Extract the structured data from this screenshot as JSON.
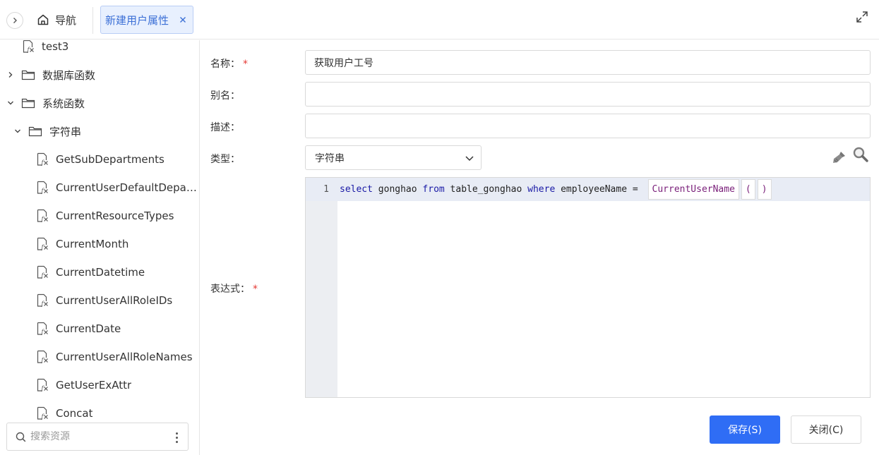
{
  "topbar": {
    "nav_label": "导航",
    "active_tab": "新建用户属性"
  },
  "sidebar": {
    "items": [
      {
        "label": "test3",
        "kind": "function",
        "level": 1
      },
      {
        "label": "数据库函数",
        "kind": "folder",
        "expanded": false,
        "level": 0
      },
      {
        "label": "系统函数",
        "kind": "folder",
        "expanded": true,
        "level": 0
      },
      {
        "label": "字符串",
        "kind": "folder",
        "expanded": true,
        "level": 1
      },
      {
        "label": "GetSubDepartments",
        "kind": "function",
        "level": 2
      },
      {
        "label": "CurrentUserDefaultDepar...",
        "kind": "function",
        "level": 2
      },
      {
        "label": "CurrentResourceTypes",
        "kind": "function",
        "level": 2
      },
      {
        "label": "CurrentMonth",
        "kind": "function",
        "level": 2
      },
      {
        "label": "CurrentDatetime",
        "kind": "function",
        "level": 2
      },
      {
        "label": "CurrentUserAllRoleIDs",
        "kind": "function",
        "level": 2
      },
      {
        "label": "CurrentDate",
        "kind": "function",
        "level": 2
      },
      {
        "label": "CurrentUserAllRoleNames",
        "kind": "function",
        "level": 2
      },
      {
        "label": "GetUserExAttr",
        "kind": "function",
        "level": 2
      },
      {
        "label": "Concat",
        "kind": "function",
        "level": 2
      }
    ],
    "search_placeholder": "搜索资源"
  },
  "form": {
    "name_label": "名称：",
    "name_value": "获取用户工号",
    "alias_label": "别名：",
    "alias_value": "",
    "desc_label": "描述：",
    "desc_value": "",
    "type_label": "类型：",
    "type_value": "字符串",
    "expr_label": "表达式：",
    "required_mark": "*"
  },
  "editor": {
    "line_number": "1",
    "tokens": [
      {
        "text": "select",
        "kw": true
      },
      {
        "text": " gonghao ",
        "kw": false
      },
      {
        "text": "from",
        "kw": true
      },
      {
        "text": " table_gonghao ",
        "kw": false
      },
      {
        "text": "where",
        "kw": true
      },
      {
        "text": " employeeName = ",
        "kw": false
      }
    ],
    "function_chip": "CurrentUserName",
    "paren_open": "(",
    "paren_close": ")"
  },
  "buttons": {
    "save": "保存(S)",
    "close": "关闭(C)"
  },
  "colors": {
    "accent": "#2f6df5",
    "tab_bg": "#e8f0fe",
    "tab_text": "#3b6fd6",
    "required": "#e53935",
    "keyword": "#1a1aa6",
    "function": "#7a1f7a"
  },
  "icons": {
    "collapse": "chevron-right-icon",
    "home": "home-icon",
    "tab_close": "close-icon",
    "fullscreen": "expand-icon",
    "folder": "folder-icon",
    "function": "function-file-icon",
    "search": "search-icon",
    "more": "more-vertical-icon",
    "format": "brush-icon",
    "find": "magnify-icon"
  }
}
